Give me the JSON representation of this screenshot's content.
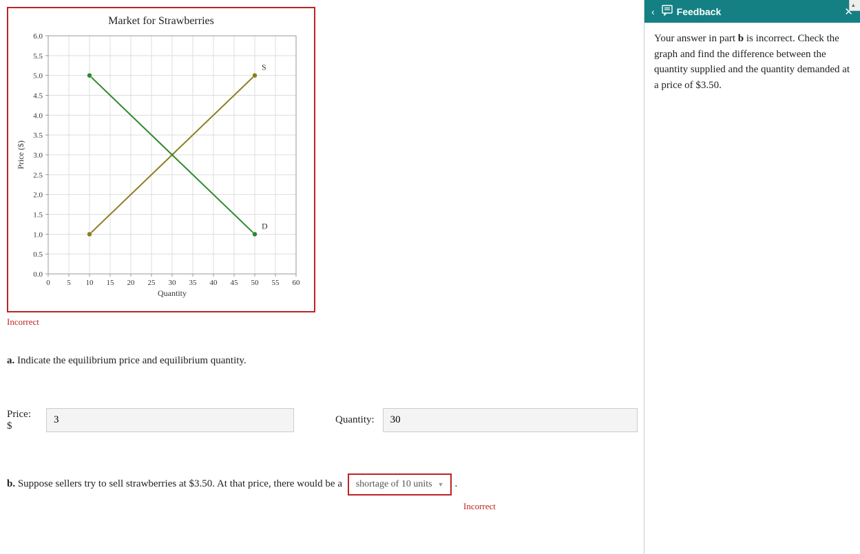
{
  "chart_data": {
    "type": "line",
    "title": "Market for Strawberries",
    "xlabel": "Quantity",
    "ylabel": "Price ($)",
    "xlim": [
      0,
      60
    ],
    "ylim": [
      0,
      6
    ],
    "x_ticks": [
      0,
      5,
      10,
      15,
      20,
      25,
      30,
      35,
      40,
      45,
      50,
      55,
      60
    ],
    "y_ticks": [
      0.0,
      0.5,
      1.0,
      1.5,
      2.0,
      2.5,
      3.0,
      3.5,
      4.0,
      4.5,
      5.0,
      5.5,
      6.0
    ],
    "series": [
      {
        "name": "S",
        "color": "#8a7d1f",
        "points": [
          [
            10,
            1.0
          ],
          [
            50,
            5.0
          ]
        ]
      },
      {
        "name": "D",
        "color": "#2d8a2d",
        "points": [
          [
            10,
            5.0
          ],
          [
            50,
            1.0
          ]
        ]
      }
    ]
  },
  "status": {
    "incorrect": "Incorrect"
  },
  "parts": {
    "a": {
      "label": "a",
      "prompt": "Indicate the equilibrium price and equilibrium quantity.",
      "price_label": "Price: $",
      "price_value": "3",
      "quantity_label": "Quantity:",
      "quantity_value": "30"
    },
    "b": {
      "label": "b",
      "prompt_before": "Suppose sellers try to sell strawberries at $3.50. At that price, there would be a",
      "dropdown_value": "shortage of 10 units",
      "prompt_after": ".",
      "incorrect": "Incorrect"
    }
  },
  "feedback": {
    "title": "Feedback",
    "body_before": "Your answer in part ",
    "body_bold": "b",
    "body_after": " is incorrect. Check the graph and find the difference between the quantity supplied and the quantity demanded at a price of $3.50."
  }
}
